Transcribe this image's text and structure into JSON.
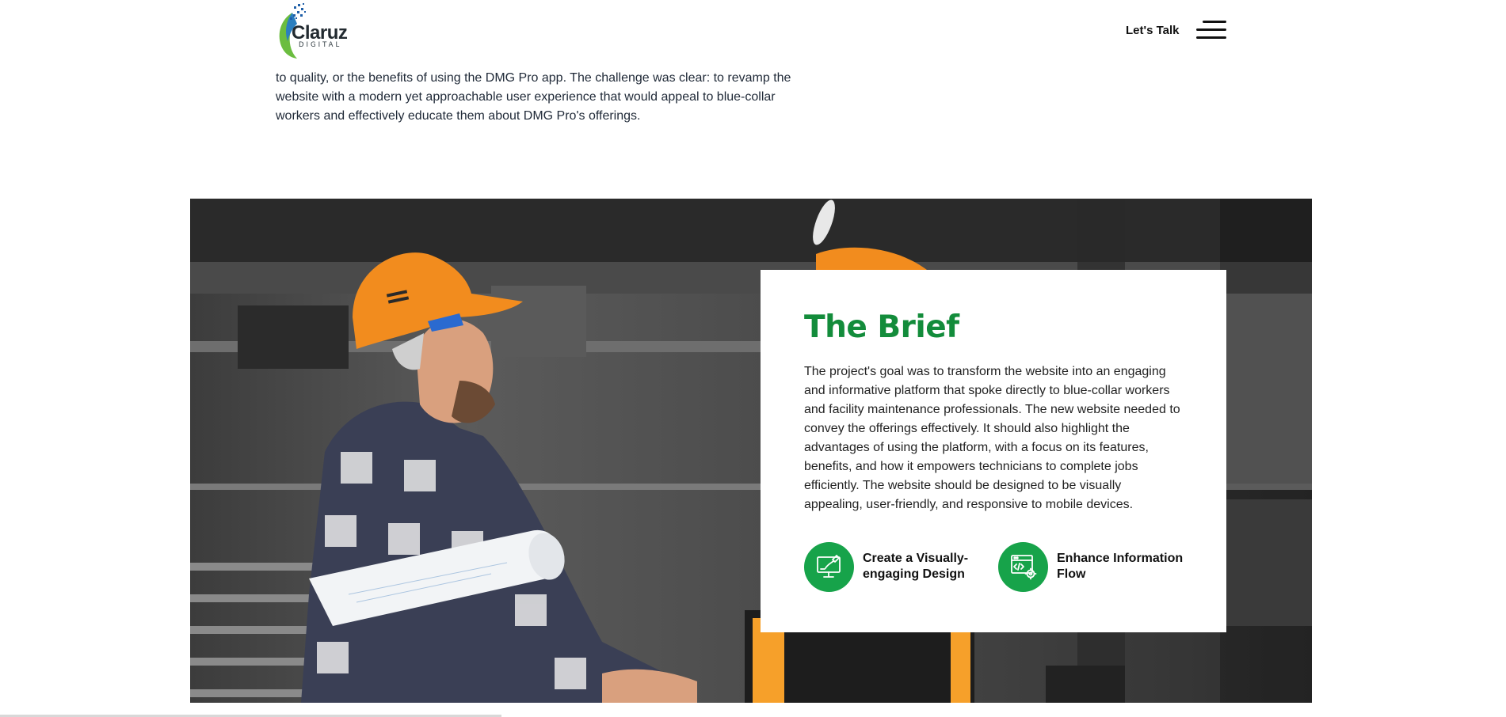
{
  "header": {
    "logo": {
      "wordmark": "Claruz",
      "subtitle": "DIGITAL"
    },
    "cta_label": "Let's Talk",
    "menu_icon": "hamburger-icon"
  },
  "intro": {
    "text": "to quality, or the benefits of using the DMG Pro app. The challenge was clear: to revamp the website with a modern yet approachable user experience that would appeal to blue-collar workers and effectively educate them about DMG Pro's offerings."
  },
  "brief": {
    "title": "The Brief",
    "body": "The project's goal was to transform the website into an engaging and informative platform that spoke directly to blue-collar workers and facility maintenance professionals. The new website needed to convey the offerings effectively. It should also highlight the advantages of using the platform, with a focus on its features, benefits, and how it empowers technicians to complete jobs efficiently. The website should be designed to be visually appealing, user-friendly, and responsive to mobile devices.",
    "features": [
      {
        "label": "Create a Visually-engaging Design",
        "icon": "design-monitor-icon"
      },
      {
        "label": "Enhance Information Flow",
        "icon": "code-settings-icon"
      }
    ]
  },
  "colors": {
    "brand_green": "#138c3b",
    "icon_green": "#17a34a",
    "helmet_orange": "#f28c1e"
  }
}
